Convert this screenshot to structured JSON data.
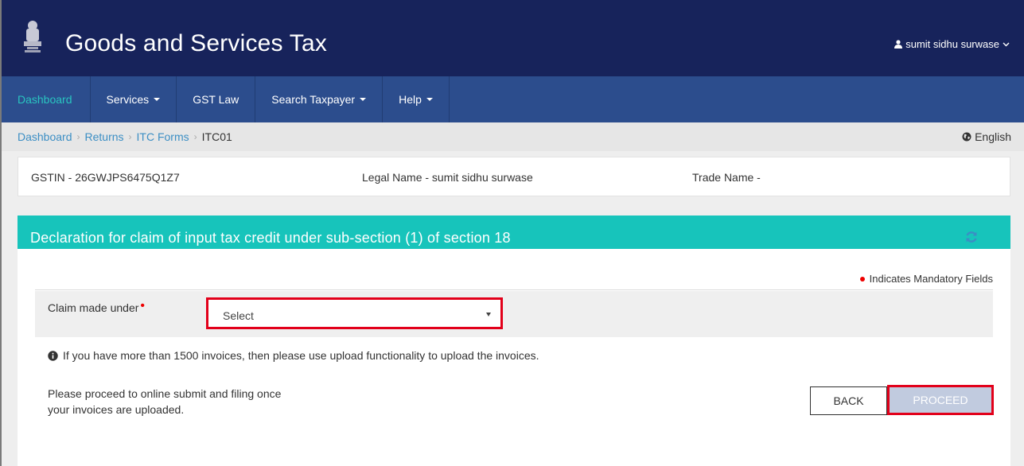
{
  "header": {
    "site_title": "Goods and Services Tax",
    "user_name": "sumit sidhu surwase",
    "emblem_icon": "national-emblem-icon"
  },
  "nav": {
    "items": [
      {
        "label": "Dashboard",
        "active": true,
        "dropdown": false
      },
      {
        "label": "Services",
        "active": false,
        "dropdown": true
      },
      {
        "label": "GST Law",
        "active": false,
        "dropdown": false
      },
      {
        "label": "Search Taxpayer",
        "active": false,
        "dropdown": true
      },
      {
        "label": "Help",
        "active": false,
        "dropdown": true
      }
    ]
  },
  "breadcrumb": {
    "items": [
      "Dashboard",
      "Returns",
      "ITC Forms"
    ],
    "current": "ITC01"
  },
  "language": "English",
  "taxpayer": {
    "gstin": "GSTIN - 26GWJPS6475Q1Z7",
    "legal_name": "Legal Name - sumit sidhu surwase",
    "trade_name": "Trade Name -"
  },
  "panel": {
    "title": "Declaration for claim of input tax credit under sub-section (1) of section 18",
    "mandatory_note": "Indicates Mandatory Fields",
    "claim_label": "Claim made under",
    "claim_value": "Select",
    "upload_note": "If you have more than 1500 invoices, then please use upload functionality to upload the invoices.",
    "help_line1": "Please proceed to online submit and filing once",
    "help_line2": "your invoices are uploaded.",
    "back_label": "BACK",
    "proceed_label": "PROCEED"
  },
  "colors": {
    "header_bg": "#17235b",
    "nav_bg": "#2c4d8d",
    "panel_head": "#17c4bb",
    "highlight": "#e2001a",
    "link": "#3b8ec4"
  }
}
